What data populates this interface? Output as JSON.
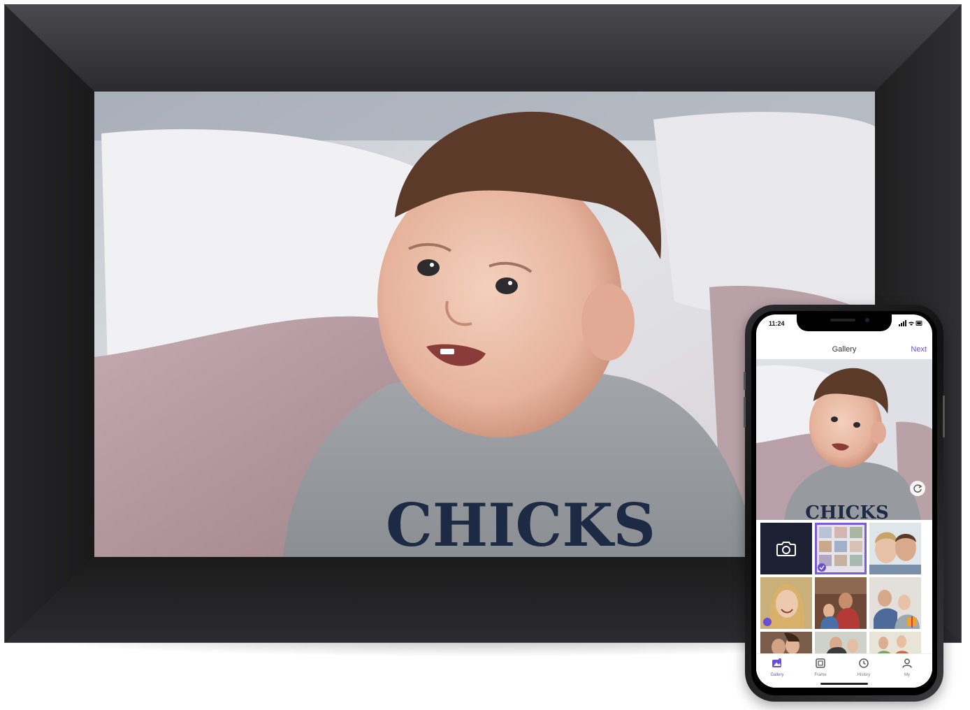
{
  "phone": {
    "status_time": "11:24",
    "header_title": "Gallery",
    "next_label": "Next",
    "preview_shirt_text": "CHICKS",
    "tabs": [
      {
        "label": "Gallery",
        "icon": "gallery-icon",
        "active": true
      },
      {
        "label": "Frame",
        "icon": "frame-icon",
        "active": false
      },
      {
        "label": "History",
        "icon": "history-icon",
        "active": false
      },
      {
        "label": "My",
        "icon": "person-icon",
        "active": false
      }
    ]
  },
  "frame": {
    "shirt_text": "CHICKS"
  },
  "colors": {
    "frame_black": "#1e1e1f",
    "accent_purple": "#6a4fd6",
    "camera_tile": "#1c2233"
  }
}
